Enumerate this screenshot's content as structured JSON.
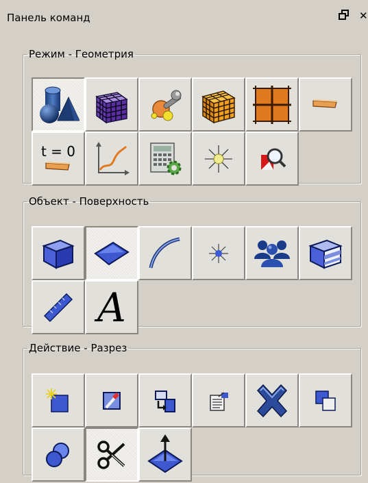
{
  "panel": {
    "title": "Панель команд"
  },
  "groups": {
    "mode": {
      "legend": "Режим - Геометрия",
      "buttons": [
        {
          "icon": "geometry-primitives-icon",
          "pressed": true
        },
        {
          "icon": "mesh-cube-icon",
          "pressed": false
        },
        {
          "icon": "tools-wrench-icon",
          "pressed": false
        },
        {
          "icon": "orange-mesh-cube-icon",
          "pressed": false
        },
        {
          "icon": "grid-plane-icon",
          "pressed": false
        },
        {
          "icon": "beam-section-icon",
          "pressed": false
        },
        {
          "icon": "time-zero-icon",
          "pressed": false,
          "label": "t = 0"
        },
        {
          "icon": "graph-curve-icon",
          "pressed": false
        },
        {
          "icon": "calculator-gear-icon",
          "pressed": false
        },
        {
          "icon": "light-burst-icon",
          "pressed": false
        },
        {
          "icon": "zoom-shape-icon",
          "pressed": false
        }
      ]
    },
    "object": {
      "legend": "Объект - Поверхность",
      "buttons": [
        {
          "icon": "solid-box-icon",
          "pressed": false
        },
        {
          "icon": "surface-icon",
          "pressed": true
        },
        {
          "icon": "curve-icon",
          "pressed": false
        },
        {
          "icon": "point-icon",
          "pressed": false
        },
        {
          "icon": "group-people-icon",
          "pressed": false
        },
        {
          "icon": "layered-box-icon",
          "pressed": false
        },
        {
          "icon": "ruler-icon",
          "pressed": false
        },
        {
          "icon": "text-a-icon",
          "pressed": false,
          "label": "A"
        }
      ]
    },
    "action": {
      "legend": "Действие - Разрез",
      "buttons": [
        {
          "icon": "new-object-icon",
          "pressed": false
        },
        {
          "icon": "edit-object-icon",
          "pressed": false
        },
        {
          "icon": "transform-icon",
          "pressed": false
        },
        {
          "icon": "properties-icon",
          "pressed": false
        },
        {
          "icon": "delete-x-icon",
          "pressed": false
        },
        {
          "icon": "copy-icon",
          "pressed": false
        },
        {
          "icon": "boolean-icon",
          "pressed": false
        },
        {
          "icon": "section-cut-icon",
          "pressed": true
        },
        {
          "icon": "extrude-icon",
          "pressed": false
        }
      ]
    }
  }
}
